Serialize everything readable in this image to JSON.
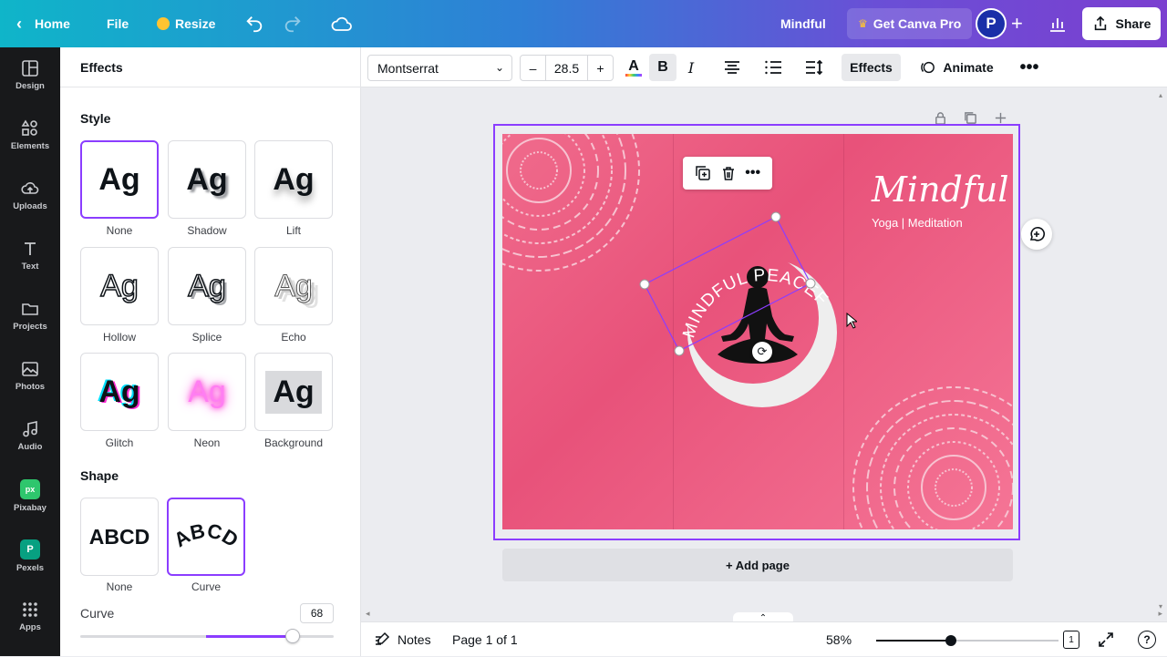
{
  "topbar": {
    "home": "Home",
    "file": "File",
    "resize": "Resize",
    "doc_title": "Mindful",
    "pro_button": "Get Canva Pro",
    "avatar_initial": "P",
    "share": "Share"
  },
  "rail": {
    "items": [
      {
        "label": "Design",
        "icon": "layout-icon"
      },
      {
        "label": "Elements",
        "icon": "shapes-icon"
      },
      {
        "label": "Uploads",
        "icon": "cloud-upload-icon"
      },
      {
        "label": "Text",
        "icon": "text-icon"
      },
      {
        "label": "Projects",
        "icon": "folder-icon"
      },
      {
        "label": "Photos",
        "icon": "image-icon"
      },
      {
        "label": "Audio",
        "icon": "music-icon"
      },
      {
        "label": "Pixabay",
        "icon": "pixabay-icon"
      },
      {
        "label": "Pexels",
        "icon": "pexels-icon"
      },
      {
        "label": "Apps",
        "icon": "apps-grid-icon"
      }
    ]
  },
  "panel": {
    "title": "Effects",
    "style_title": "Style",
    "sample": "Ag",
    "styles": [
      "None",
      "Shadow",
      "Lift",
      "Hollow",
      "Splice",
      "Echo",
      "Glitch",
      "Neon",
      "Background"
    ],
    "shape_title": "Shape",
    "shape_sample": "ABCD",
    "shapes": [
      "None",
      "Curve"
    ],
    "curve_label": "Curve",
    "curve_value": "68",
    "curve_fraction": 0.84
  },
  "toolbar": {
    "font": "Montserrat",
    "minus": "–",
    "font_size": "28.5",
    "plus": "+",
    "effects": "Effects",
    "animate": "Animate"
  },
  "canvas": {
    "title": "Mindful",
    "subtitle": "Yoga | Meditation",
    "curved_text": "MINDFUL PEACEFUL",
    "add_page": "+ Add page",
    "colors": {
      "accent": "#8b3dff",
      "page_pink": "#e8527a"
    }
  },
  "bottombar": {
    "notes": "Notes",
    "page_indicator": "Page 1 of 1",
    "zoom": "58%",
    "page_count": "1",
    "help": "?"
  }
}
